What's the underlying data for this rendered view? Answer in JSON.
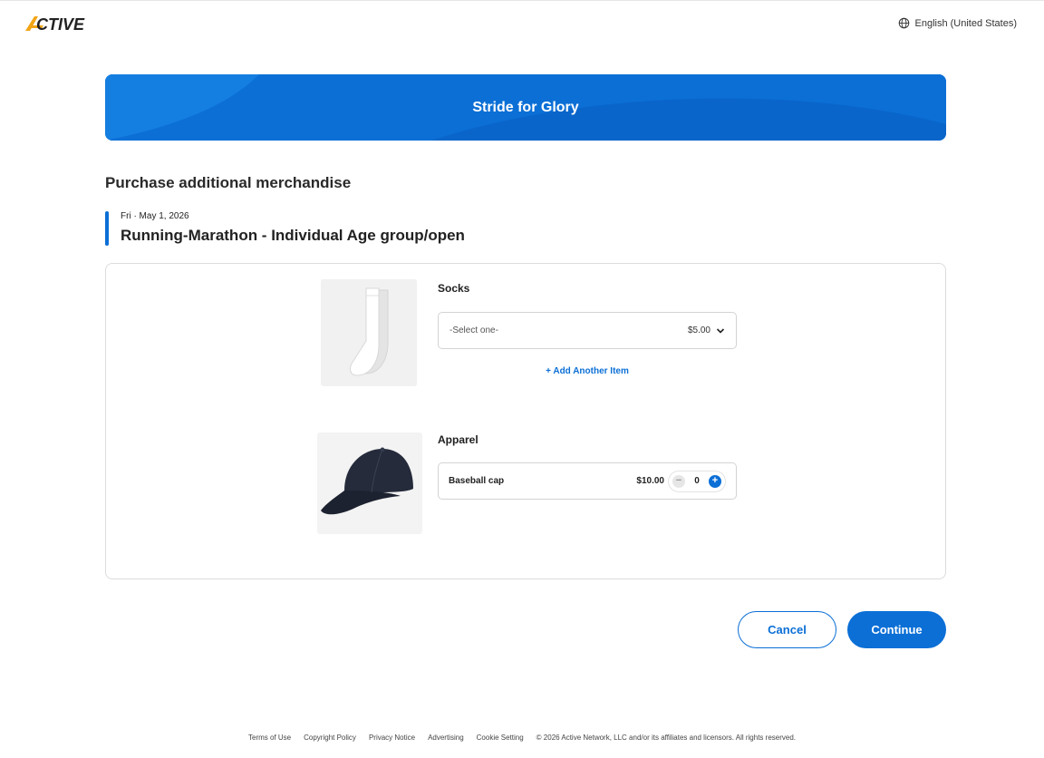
{
  "header": {
    "logo_text": "ACTIVE",
    "language": "English (United States)"
  },
  "banner": {
    "title": "Stride for Glory"
  },
  "page": {
    "section_title": "Purchase additional merchandise"
  },
  "event": {
    "date": "Fri · May 1, 2026",
    "name": "Running-Marathon - Individual Age group/open"
  },
  "products": [
    {
      "name": "Socks",
      "select_placeholder": "-Select one-",
      "price": "$5.00",
      "add_link": "+ Add Another Item"
    },
    {
      "name": "Apparel",
      "item_label": "Baseball cap",
      "price": "$10.00",
      "quantity": "0"
    }
  ],
  "actions": {
    "cancel": "Cancel",
    "continue": "Continue"
  },
  "footer": {
    "links": [
      "Terms of Use",
      "Copyright Policy",
      "Privacy Notice",
      "Advertising",
      "Cookie Setting"
    ],
    "copyright": "© 2026 Active Network, LLC and/or its affiliates and licensors. All rights reserved."
  },
  "colors": {
    "accent": "#0b6fd6",
    "logo_orange": "#f2a516"
  }
}
